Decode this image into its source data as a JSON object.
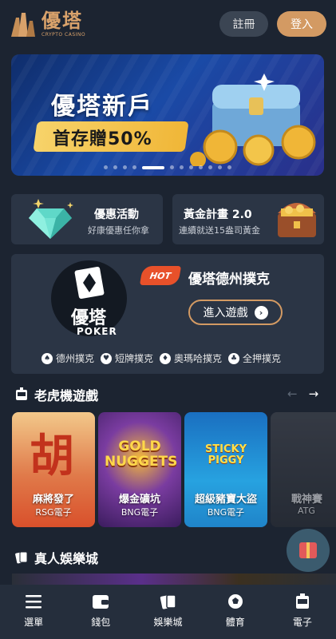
{
  "header": {
    "logo_title": "優塔",
    "logo_sub": "CRYPTO CASINO",
    "register_label": "註冊",
    "login_label": "登入"
  },
  "banner": {
    "title": "優塔新戶",
    "subtitle": "首存贈50%",
    "slide_count": 12,
    "active_slide": 5
  },
  "promos": [
    {
      "title": "優惠活動",
      "desc": "好康優惠任你拿",
      "icon": "diamond-icon"
    },
    {
      "title": "黃金計畫 2.0",
      "desc": "連續就送15盎司黃金",
      "icon": "treasure-chest-icon"
    }
  ],
  "poker": {
    "logo_title": "優塔",
    "logo_sub": "POKER",
    "hot_label": "HOT",
    "title": "優塔德州撲克",
    "enter_label": "進入遊戲",
    "tags": [
      "德州撲克",
      "短牌撲克",
      "奧瑪哈撲克",
      "全押撲克"
    ]
  },
  "slots": {
    "heading": "老虎機遊戲",
    "games": [
      {
        "name": "麻將發了",
        "provider": "RSG電子",
        "art": "胡",
        "color": "#d9502b"
      },
      {
        "name": "爆金礦坑",
        "provider": "BNG電子",
        "art": "GOLD NUGGETS",
        "color": "#5a2b84"
      },
      {
        "name": "超級豬寶大盜",
        "provider": "BNG電子",
        "art": "STICKY PIGGY",
        "color": "#1f84c9"
      },
      {
        "name": "戰神賽",
        "provider": "ATG",
        "art": "",
        "color": "#3a3d44"
      }
    ]
  },
  "live": {
    "heading": "真人娛樂城"
  },
  "nav": [
    {
      "label": "選單",
      "icon": "menu-icon"
    },
    {
      "label": "錢包",
      "icon": "wallet-icon"
    },
    {
      "label": "娛樂城",
      "icon": "cards-icon"
    },
    {
      "label": "體育",
      "icon": "soccer-ball-icon"
    },
    {
      "label": "電子",
      "icon": "slot-machine-icon"
    }
  ]
}
